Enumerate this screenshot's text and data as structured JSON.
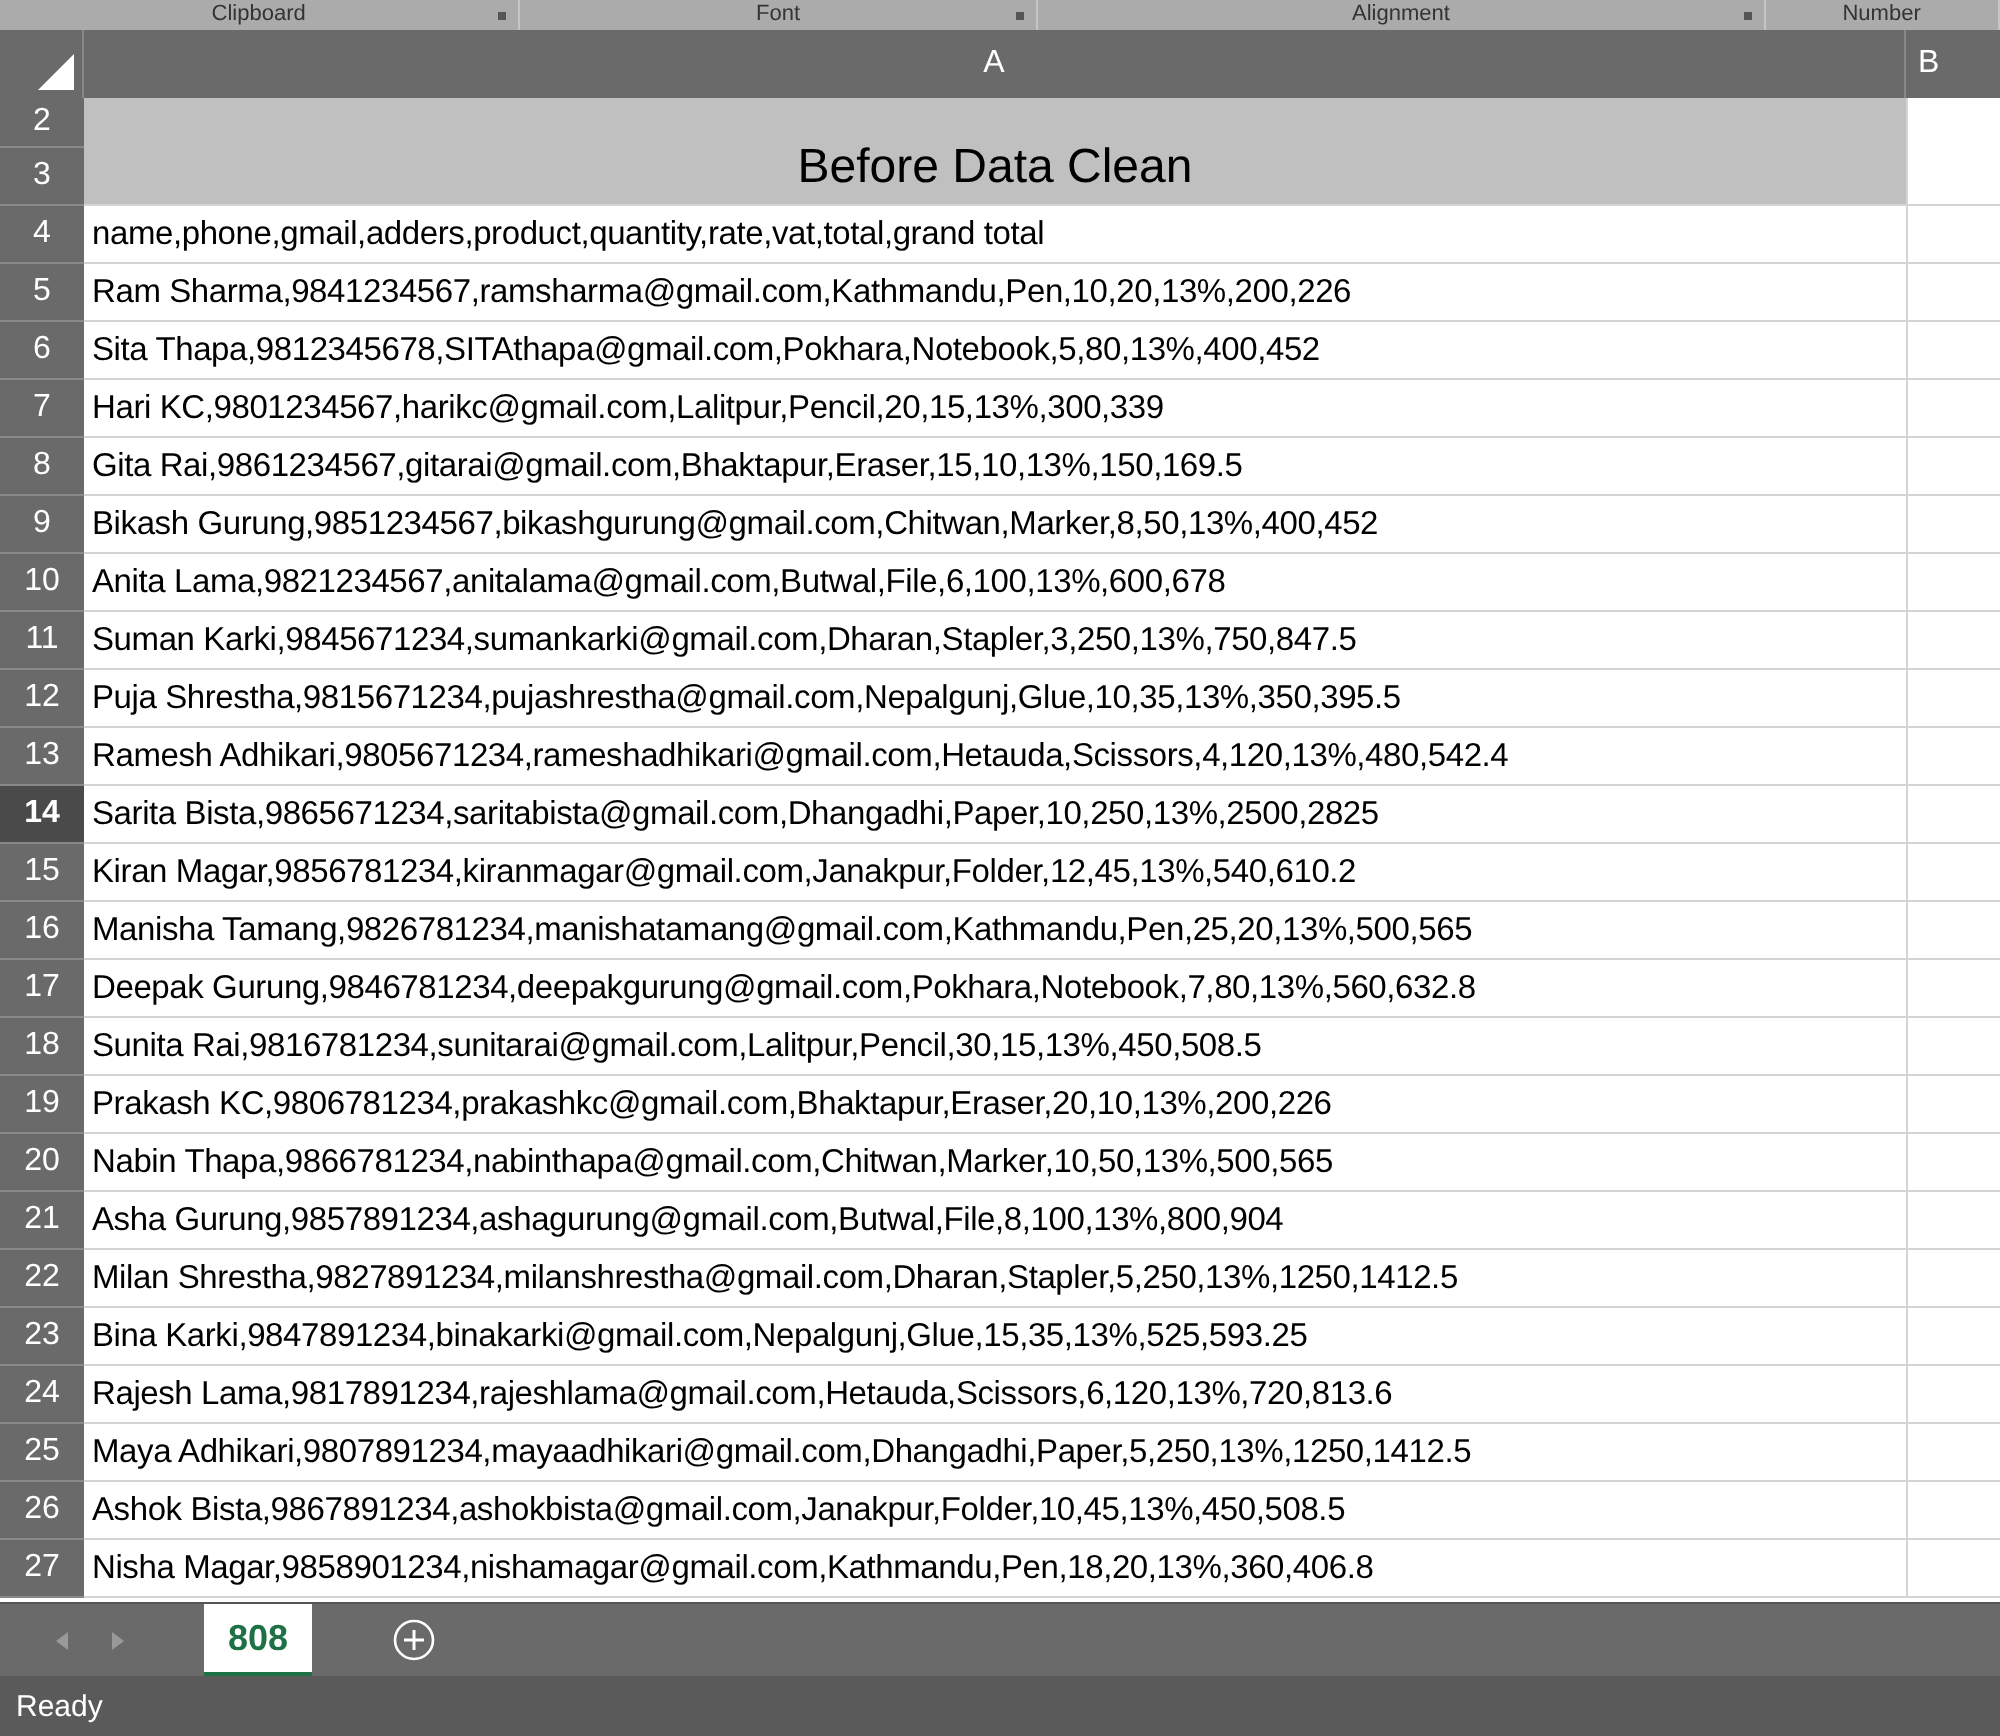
{
  "ribbon_groups": [
    "Clipboard",
    "Font",
    "Alignment",
    "Number"
  ],
  "columns": [
    "A",
    "B"
  ],
  "title_row": {
    "row_numbers": [
      "2",
      "3"
    ],
    "text": "Before Data Clean"
  },
  "rows": [
    {
      "number": "4",
      "text": "name,phone,gmail,adders,product,quantity,rate,vat,total,grand total",
      "selected": false
    },
    {
      "number": "5",
      "text": "Ram Sharma,9841234567,ramsharma@gmail.com,Kathmandu,Pen,10,20,13%,200,226",
      "selected": false
    },
    {
      "number": "6",
      "text": "Sita Thapa,9812345678,SITAthapa@gmail.com,Pokhara,Notebook,5,80,13%,400,452",
      "selected": false
    },
    {
      "number": "7",
      "text": "Hari KC,9801234567,harikc@gmail.com,Lalitpur,Pencil,20,15,13%,300,339",
      "selected": false
    },
    {
      "number": "8",
      "text": "Gita Rai,9861234567,gitarai@gmail.com,Bhaktapur,Eraser,15,10,13%,150,169.5",
      "selected": false
    },
    {
      "number": "9",
      "text": "Bikash Gurung,9851234567,bikashgurung@gmail.com,Chitwan,Marker,8,50,13%,400,452",
      "selected": false
    },
    {
      "number": "10",
      "text": "Anita Lama,9821234567,anitalama@gmail.com,Butwal,File,6,100,13%,600,678",
      "selected": false
    },
    {
      "number": "11",
      "text": "Suman Karki,9845671234,sumankarki@gmail.com,Dharan,Stapler,3,250,13%,750,847.5",
      "selected": false
    },
    {
      "number": "12",
      "text": "Puja Shrestha,9815671234,pujashrestha@gmail.com,Nepalgunj,Glue,10,35,13%,350,395.5",
      "selected": false
    },
    {
      "number": "13",
      "text": "Ramesh Adhikari,9805671234,rameshadhikari@gmail.com,Hetauda,Scissors,4,120,13%,480,542.4",
      "selected": false
    },
    {
      "number": "14",
      "text": "Sarita Bista,9865671234,saritabista@gmail.com,Dhangadhi,Paper,10,250,13%,2500,2825",
      "selected": true
    },
    {
      "number": "15",
      "text": "Kiran Magar,9856781234,kiranmagar@gmail.com,Janakpur,Folder,12,45,13%,540,610.2",
      "selected": false
    },
    {
      "number": "16",
      "text": "Manisha Tamang,9826781234,manishatamang@gmail.com,Kathmandu,Pen,25,20,13%,500,565",
      "selected": false
    },
    {
      "number": "17",
      "text": "Deepak Gurung,9846781234,deepakgurung@gmail.com,Pokhara,Notebook,7,80,13%,560,632.8",
      "selected": false
    },
    {
      "number": "18",
      "text": "Sunita Rai,9816781234,sunitarai@gmail.com,Lalitpur,Pencil,30,15,13%,450,508.5",
      "selected": false
    },
    {
      "number": "19",
      "text": "Prakash KC,9806781234,prakashkc@gmail.com,Bhaktapur,Eraser,20,10,13%,200,226",
      "selected": false
    },
    {
      "number": "20",
      "text": "Nabin Thapa,9866781234,nabinthapa@gmail.com,Chitwan,Marker,10,50,13%,500,565",
      "selected": false
    },
    {
      "number": "21",
      "text": "Asha Gurung,9857891234,ashagurung@gmail.com,Butwal,File,8,100,13%,800,904",
      "selected": false
    },
    {
      "number": "22",
      "text": "Milan Shrestha,9827891234,milanshrestha@gmail.com,Dharan,Stapler,5,250,13%,1250,1412.5",
      "selected": false
    },
    {
      "number": "23",
      "text": "Bina Karki,9847891234,binakarki@gmail.com,Nepalgunj,Glue,15,35,13%,525,593.25",
      "selected": false
    },
    {
      "number": "24",
      "text": "Rajesh Lama,9817891234,rajeshlama@gmail.com,Hetauda,Scissors,6,120,13%,720,813.6",
      "selected": false
    },
    {
      "number": "25",
      "text": "Maya Adhikari,9807891234,mayaadhikari@gmail.com,Dhangadhi,Paper,5,250,13%,1250,1412.5",
      "selected": false
    },
    {
      "number": "26",
      "text": "Ashok Bista,9867891234,ashokbista@gmail.com,Janakpur,Folder,10,45,13%,450,508.5",
      "selected": false
    },
    {
      "number": "27",
      "text": "Nisha Magar,9858901234,nishamagar@gmail.com,Kathmandu,Pen,18,20,13%,360,406.8",
      "selected": false
    }
  ],
  "sheet_tabs": [
    {
      "label": "808",
      "selected": true
    }
  ],
  "status_bar": {
    "text": "Ready"
  }
}
